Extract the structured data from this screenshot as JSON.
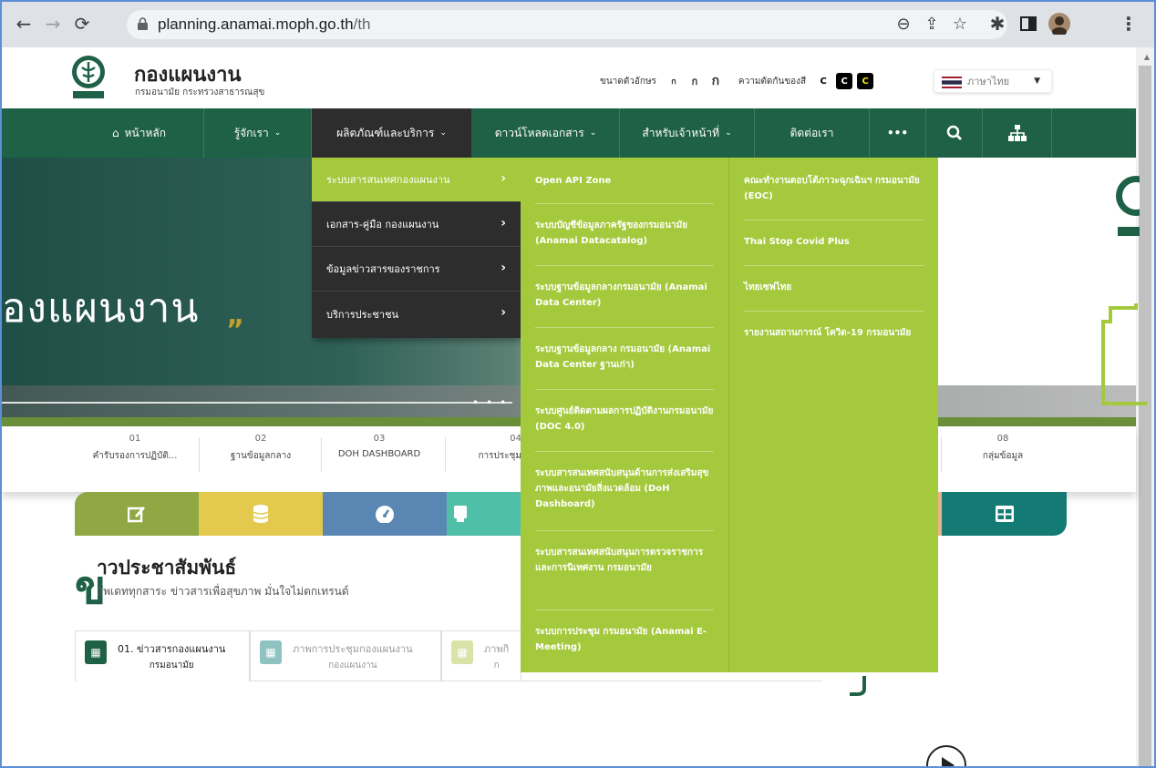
{
  "browser": {
    "url_domain": "planning.anamai.moph.go.th",
    "url_path": "/th"
  },
  "header": {
    "title": "กองแผนงาน",
    "subtitle": "กรมอนามัย กระทรวงสาธารณสุข",
    "font_size_label": "ขนาดตัวอักษร",
    "font_sizes": [
      "ก",
      "ก",
      "ก"
    ],
    "contrast_label": "ความตัดกันของสี",
    "contrast_options": [
      "C",
      "C",
      "C"
    ],
    "language": "ภาษาไทย"
  },
  "nav": {
    "items": [
      "หน้าหลัก",
      "รู้จักเรา",
      "ผลิตภัณฑ์และบริการ",
      "ดาวน์โหลดเอกสาร",
      "สำหรับเจ้าหน้าที่",
      "ติดต่อเรา"
    ],
    "more": "•••"
  },
  "dropdown_level1": [
    "ระบบสารสนเทศกองแผนงาน",
    "เอกสาร-คู่มือ กองแผนงาน",
    "ข้อมูลข่าวสารของราชการ",
    "บริการประชาชน"
  ],
  "dropdown_level2": [
    "Open API Zone",
    "ระบบบัญชีข้อมูลภาครัฐของกรมอนามัย (Anamai Datacatalog)",
    "ระบบฐานข้อมูลกลางกรมอนามัย (Anamai Data Center)",
    "ระบบฐานข้อมูลกลาง กรมอนามัย (Anamai Data Center ฐานเก่า)",
    "ระบบศูนย์ติดตามผลการปฏิบัติงานกรมอนามัย (DOC 4.0)",
    "ระบบสารสนเทศสนับสนุนด้านการส่งเสริมสุขภาพและอนามัยสิ่งแวดล้อม (DoH Dashboard)",
    "ระบบสารสนเทศสนับสนุนการตรวจราชการและการนิเทศงาน กรมอนามัย",
    "ระบบการประชุม กรมอนามัย (Anamai E-Meeting)"
  ],
  "dropdown_level3": [
    "คณะทำงานตอบโต้ภาวะฉุกเฉินฯ กรมอนามัย (EOC)",
    "Thai Stop Covid Plus",
    "ไทยเซฟไทย",
    "รายงานสถานการณ์ โควิด-19 กรมอนามัย"
  ],
  "hero": {
    "title": "องแผนงาน",
    "quote_mark": "”"
  },
  "quick_links": [
    {
      "num": "01",
      "label": "คำรับรองการปฏิบัติ..."
    },
    {
      "num": "02",
      "label": "ฐานข้อมูลกลาง"
    },
    {
      "num": "03",
      "label": "DOH DASHBOARD"
    },
    {
      "num": "04",
      "label": "การประชุม"
    },
    {
      "num": "08",
      "label": "กลุ่มข้อมูล"
    }
  ],
  "news": {
    "big_letter": "ข",
    "title": "าวประชาสัมพันธ์",
    "subtitle": "อัพเดททุกสาระ ข่าวสารเพื่อสุขภาพ มั่นใจไม่ตกเทรนด์",
    "tabs": [
      {
        "label": "01. ข่าวสารกองแผนงาน",
        "sub": "กรมอนามัย"
      },
      {
        "label": "ภาพการประชุมกองแผนงาน",
        "sub": "กองแผนงาน"
      },
      {
        "label": "ภาพกิ",
        "sub": "ก"
      }
    ]
  },
  "colors": {
    "nav_green": "#1f6147",
    "menu_lime": "#a4c93d",
    "menu_dark": "#2d2d2d"
  }
}
